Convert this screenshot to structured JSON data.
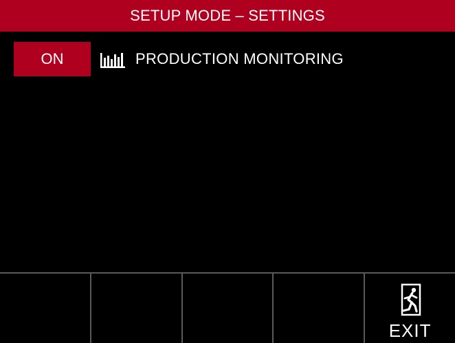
{
  "header": {
    "title": "SETUP MODE – SETTINGS"
  },
  "settings": {
    "production_monitoring": {
      "toggle_value": "ON",
      "icon": "bar-chart-icon",
      "label": "PRODUCTION MONITORING"
    }
  },
  "footer": {
    "exit_label": "EXIT",
    "exit_icon": "emergency-exit-icon"
  },
  "colors": {
    "accent": "#b0001f",
    "background": "#000000",
    "divider": "#5a5a5a",
    "text": "#ffffff"
  }
}
